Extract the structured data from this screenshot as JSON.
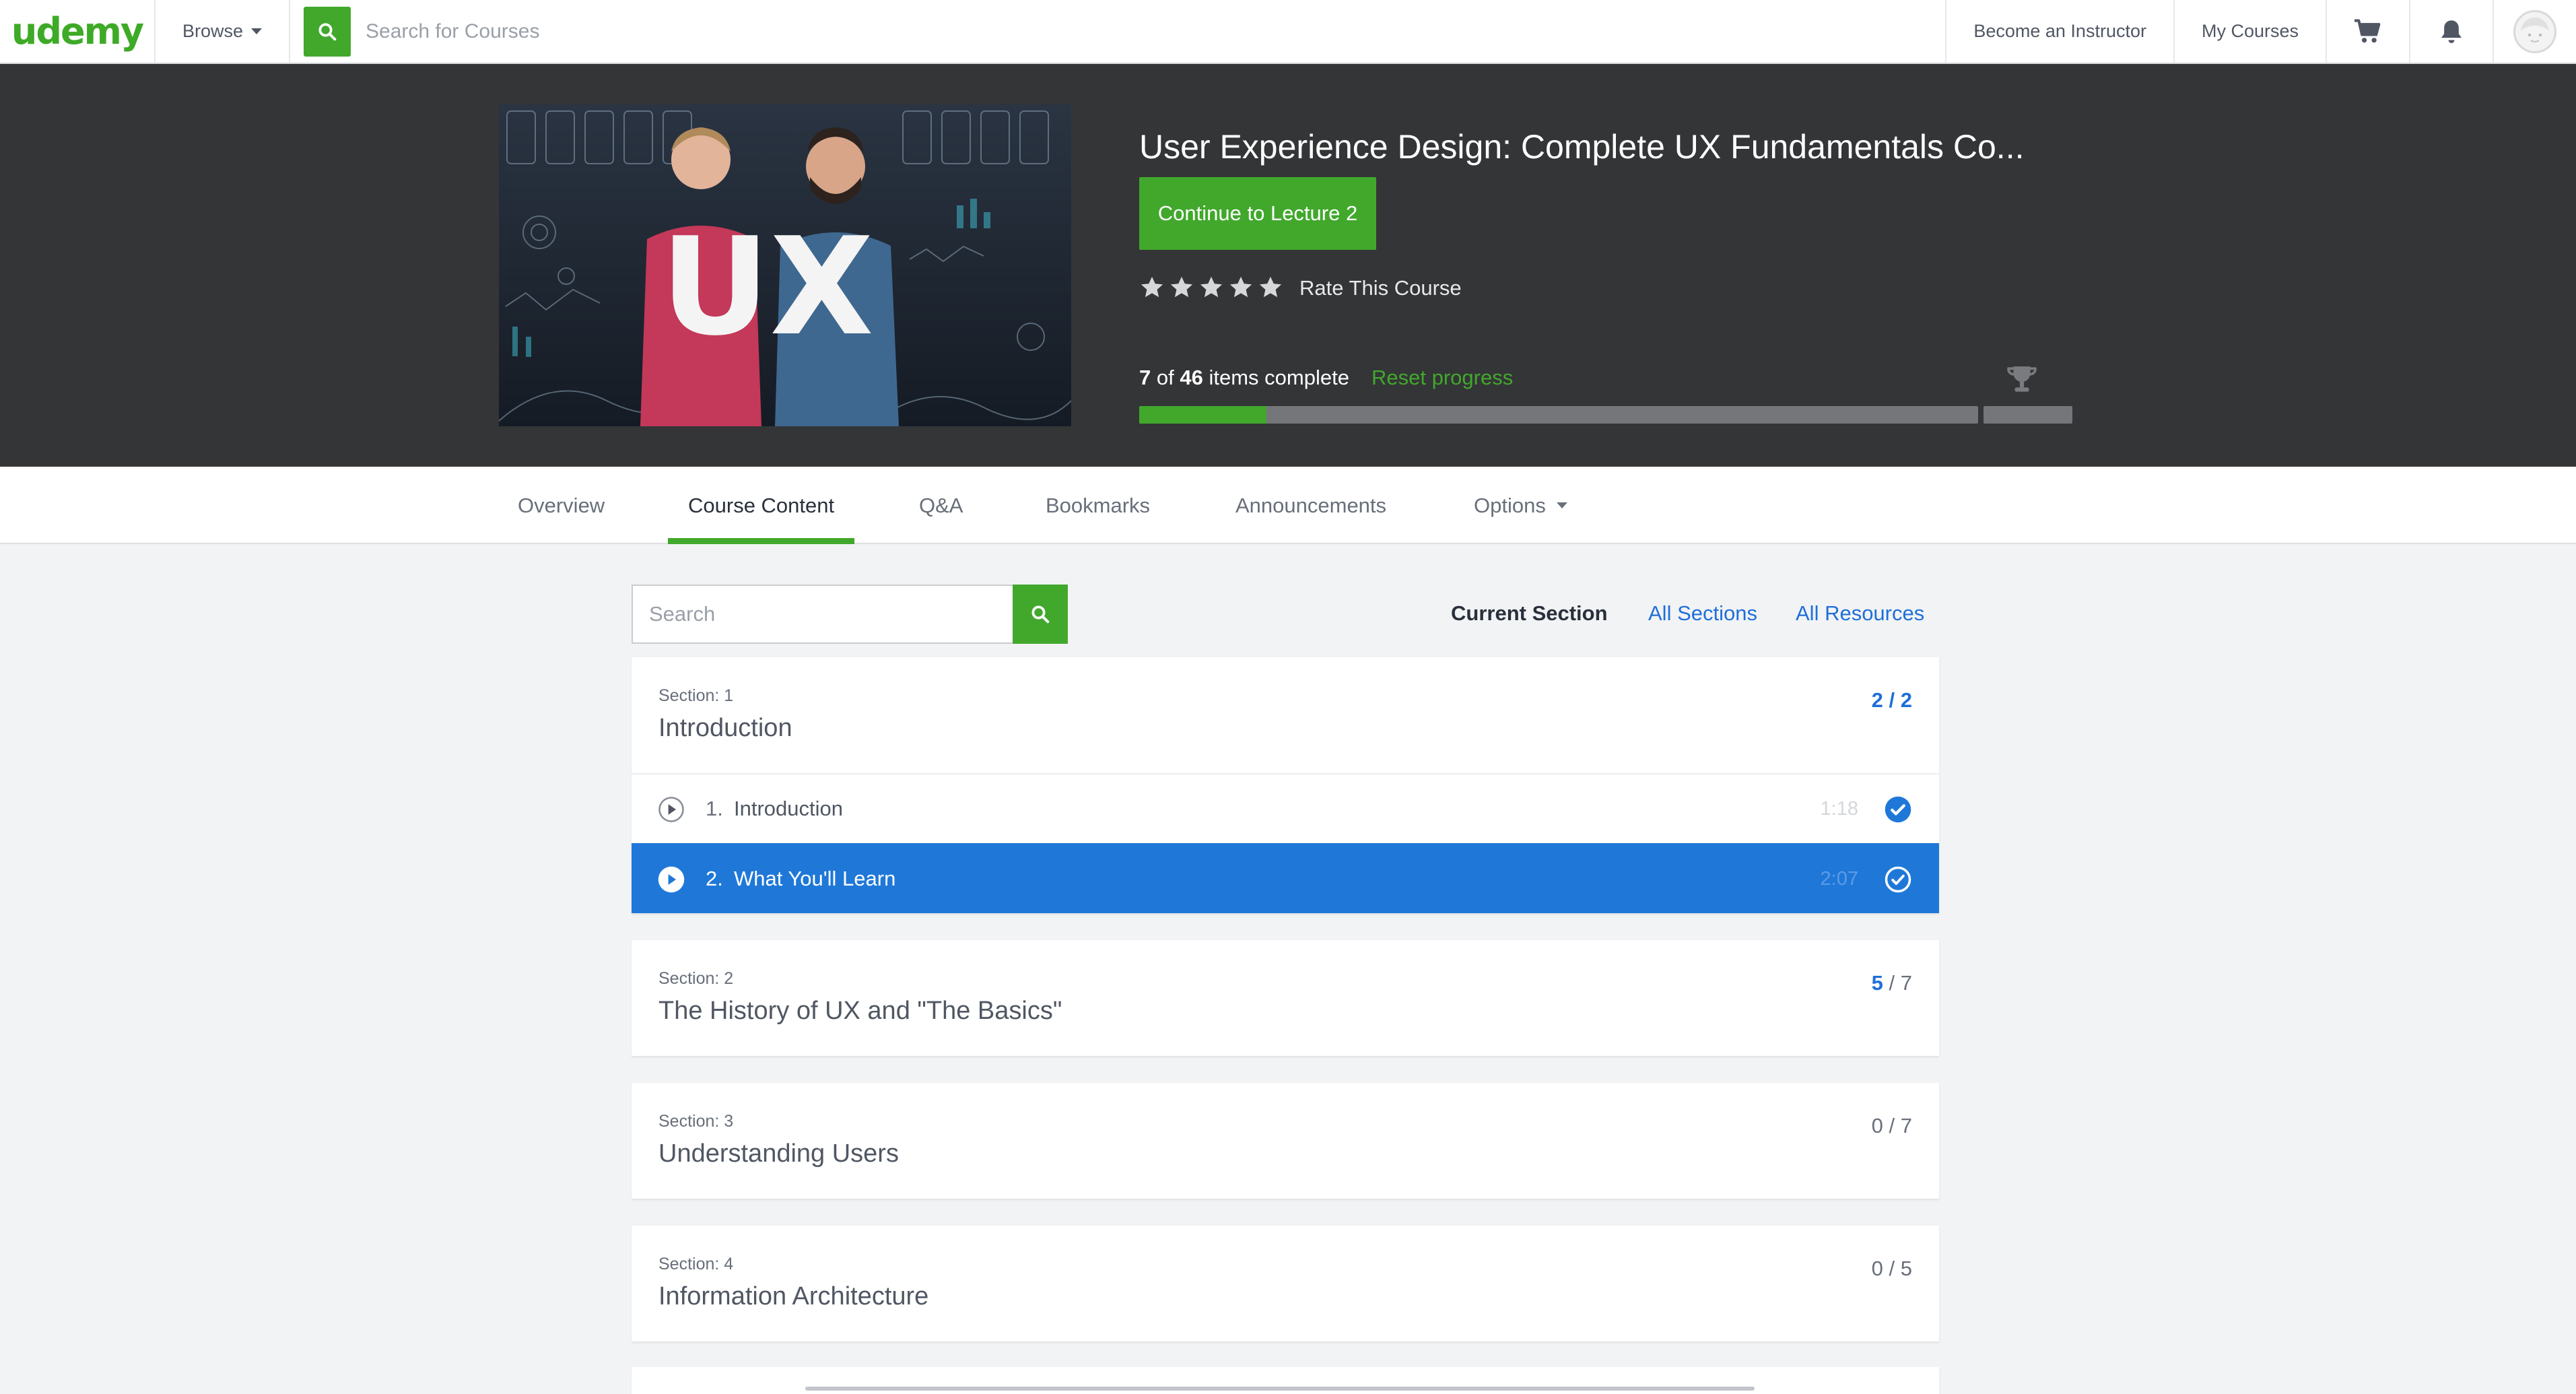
{
  "topnav": {
    "logo": "udemy",
    "browse_label": "Browse",
    "search_placeholder": "Search for Courses",
    "become_instructor": "Become an Instructor",
    "my_courses": "My Courses"
  },
  "course": {
    "title": "User Experience Design: Complete UX Fundamentals Co...",
    "continue_label": "Continue to Lecture 2",
    "rating_stars": 5,
    "rate_label": "Rate This Course",
    "progress": {
      "completed": "7",
      "of_word": "of",
      "total": "46",
      "suffix": "items complete",
      "fraction": 0.152
    },
    "reset_label": "Reset progress",
    "thumbnail_text": "UX"
  },
  "tabs": {
    "overview": "Overview",
    "course_content": "Course Content",
    "qa": "Q&A",
    "bookmarks": "Bookmarks",
    "announcements": "Announcements",
    "options": "Options"
  },
  "content": {
    "search_placeholder": "Search",
    "filter_current": "Current Section",
    "filter_all_sections": "All Sections",
    "filter_all_resources": "All Resources"
  },
  "sections": [
    {
      "label": "Section: 1",
      "name": "Introduction",
      "done": "2",
      "total": "2",
      "lectures": [
        {
          "num": "1.",
          "name": "Introduction",
          "duration": "1:18"
        },
        {
          "num": "2.",
          "name": "What You'll Learn",
          "duration": "2:07"
        }
      ]
    },
    {
      "label": "Section: 2",
      "name": "The History of UX and \"The Basics\"",
      "done": "5",
      "total": "7"
    },
    {
      "label": "Section: 3",
      "name": "Understanding Users",
      "done": "0",
      "total": "7"
    },
    {
      "label": "Section: 4",
      "name": "Information Architecture",
      "done": "0",
      "total": "5"
    }
  ],
  "colors": {
    "brand_green": "#41a82c",
    "header_dark": "#343537",
    "accent_blue": "#1f78d8"
  }
}
